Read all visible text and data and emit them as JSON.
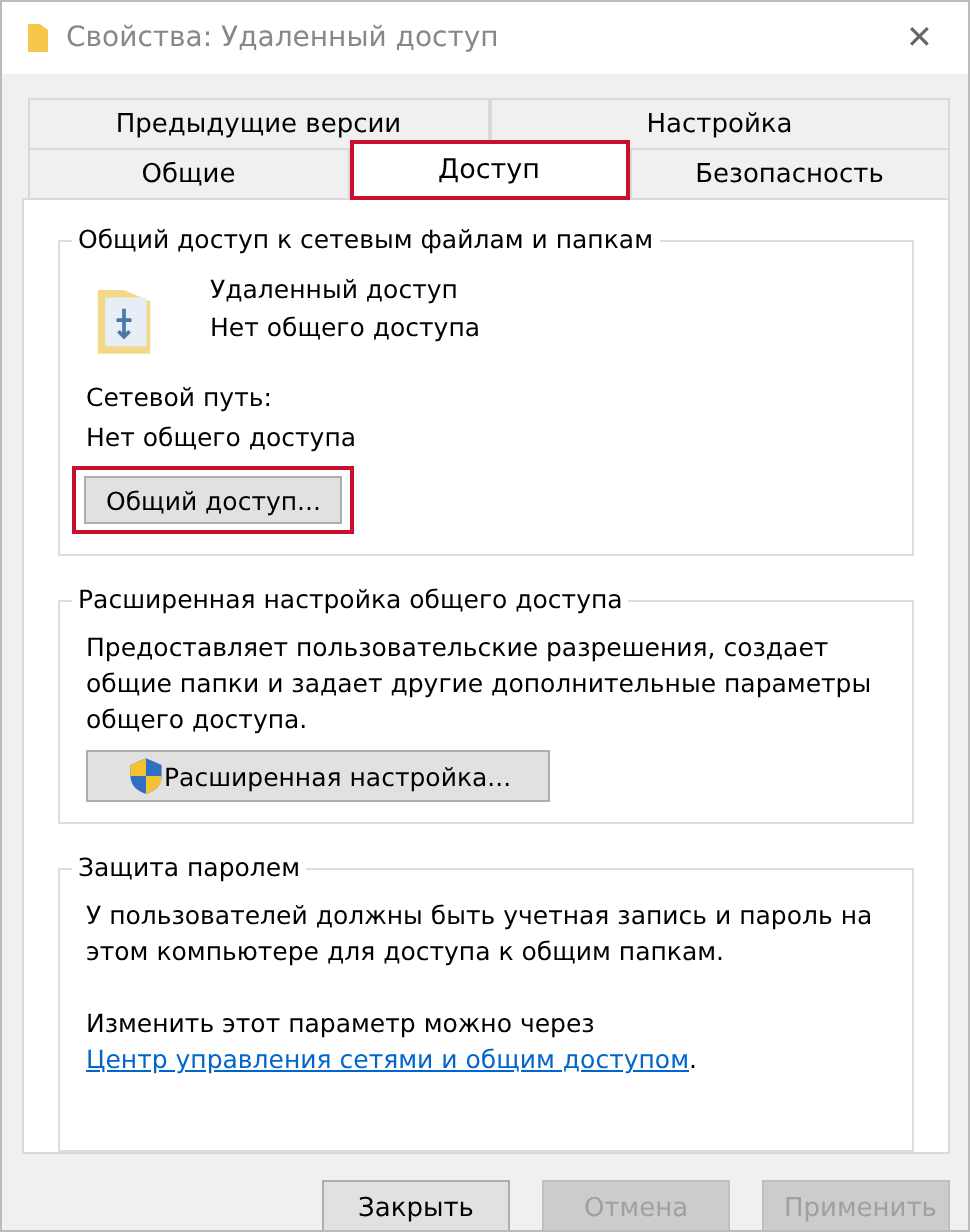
{
  "window": {
    "title": "Свойства: Удаленный доступ",
    "close": "✕"
  },
  "tab_rows": [
    [
      {
        "label": "Предыдущие версии",
        "selected": false,
        "highlighted": false
      },
      {
        "label": "Настройка",
        "selected": false,
        "highlighted": false
      }
    ],
    [
      {
        "label": "Общие",
        "selected": false,
        "highlighted": false
      },
      {
        "label": "Доступ",
        "selected": true,
        "highlighted": true
      },
      {
        "label": "Безопасность",
        "selected": false,
        "highlighted": false
      }
    ]
  ],
  "sharing": {
    "title": "Общий доступ к сетевым файлам и папкам",
    "name": "Удаленный доступ",
    "status": "Нет общего доступа",
    "path_label": "Сетевой путь:",
    "path_value": "Нет общего доступа",
    "button": {
      "label": "Общий доступ...",
      "highlighted": true
    }
  },
  "advanced": {
    "title": "Расширенная настройка общего доступа",
    "description": "Предоставляет пользовательские разрешения, создает общие папки и задает другие дополнительные параметры общего доступа.",
    "button": "Расширенная настройка..."
  },
  "password": {
    "title": "Защита паролем",
    "description": "У пользователей должны быть учетная запись и пароль на этом компьютере для доступа к общим папкам.",
    "note": "Изменить этот параметр можно через",
    "link": "Центр управления сетями и общим доступом",
    "note_end": "."
  },
  "buttons": [
    {
      "label": "Закрыть",
      "disabled": false
    },
    {
      "label": "Отмена",
      "disabled": true
    },
    {
      "label": "Применить",
      "disabled": true
    }
  ]
}
